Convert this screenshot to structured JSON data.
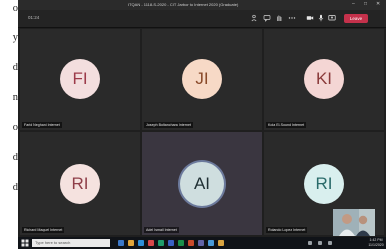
{
  "document_edge": {
    "lines": [
      "o",
      "y",
      "d",
      "n",
      "o",
      "d",
      "d"
    ]
  },
  "window": {
    "title": "ITQAN - 1118-S-2020 - CIT Jarbor to Internet 2020 (Graduate)",
    "controls": [
      "–",
      "□",
      "✕"
    ]
  },
  "toolbar": {
    "timer": "01:24",
    "leave_label": "Leave",
    "icons": [
      "people-icon",
      "chat-icon",
      "raise-hand-icon",
      "more-icon",
      "camera-icon",
      "mic-icon",
      "share-icon"
    ]
  },
  "participants": [
    {
      "initials": "FI",
      "name": "Farid Neghani Internet",
      "avatar_bg": "#f3dede",
      "initials_color": "#9c3b4a"
    },
    {
      "initials": "JI",
      "name": "Joseph Boltanchara Internet",
      "avatar_bg": "#f7d9c6",
      "initials_color": "#8a4a2a"
    },
    {
      "initials": "KI",
      "name": "Kola El-Sound Internet",
      "avatar_bg": "#f4d6d4",
      "initials_color": "#8a3a3a"
    },
    {
      "initials": "RI",
      "name": "Richard Maquel Internet",
      "avatar_bg": "#f5e2df",
      "initials_color": "#8f3f49"
    },
    {
      "initials": "AI",
      "name": "Adel Ismail Internet",
      "avatar_bg": "#cfdedf",
      "initials_color": "#1f2f33"
    },
    {
      "initials": "RI",
      "name": "Rolando Lopez Internet",
      "avatar_bg": "#d9efee",
      "initials_color": "#2a6b6a"
    }
  ],
  "taskbar": {
    "search_placeholder": "Type here to search",
    "time": "1:42 PM",
    "date": "11/1/2020"
  }
}
